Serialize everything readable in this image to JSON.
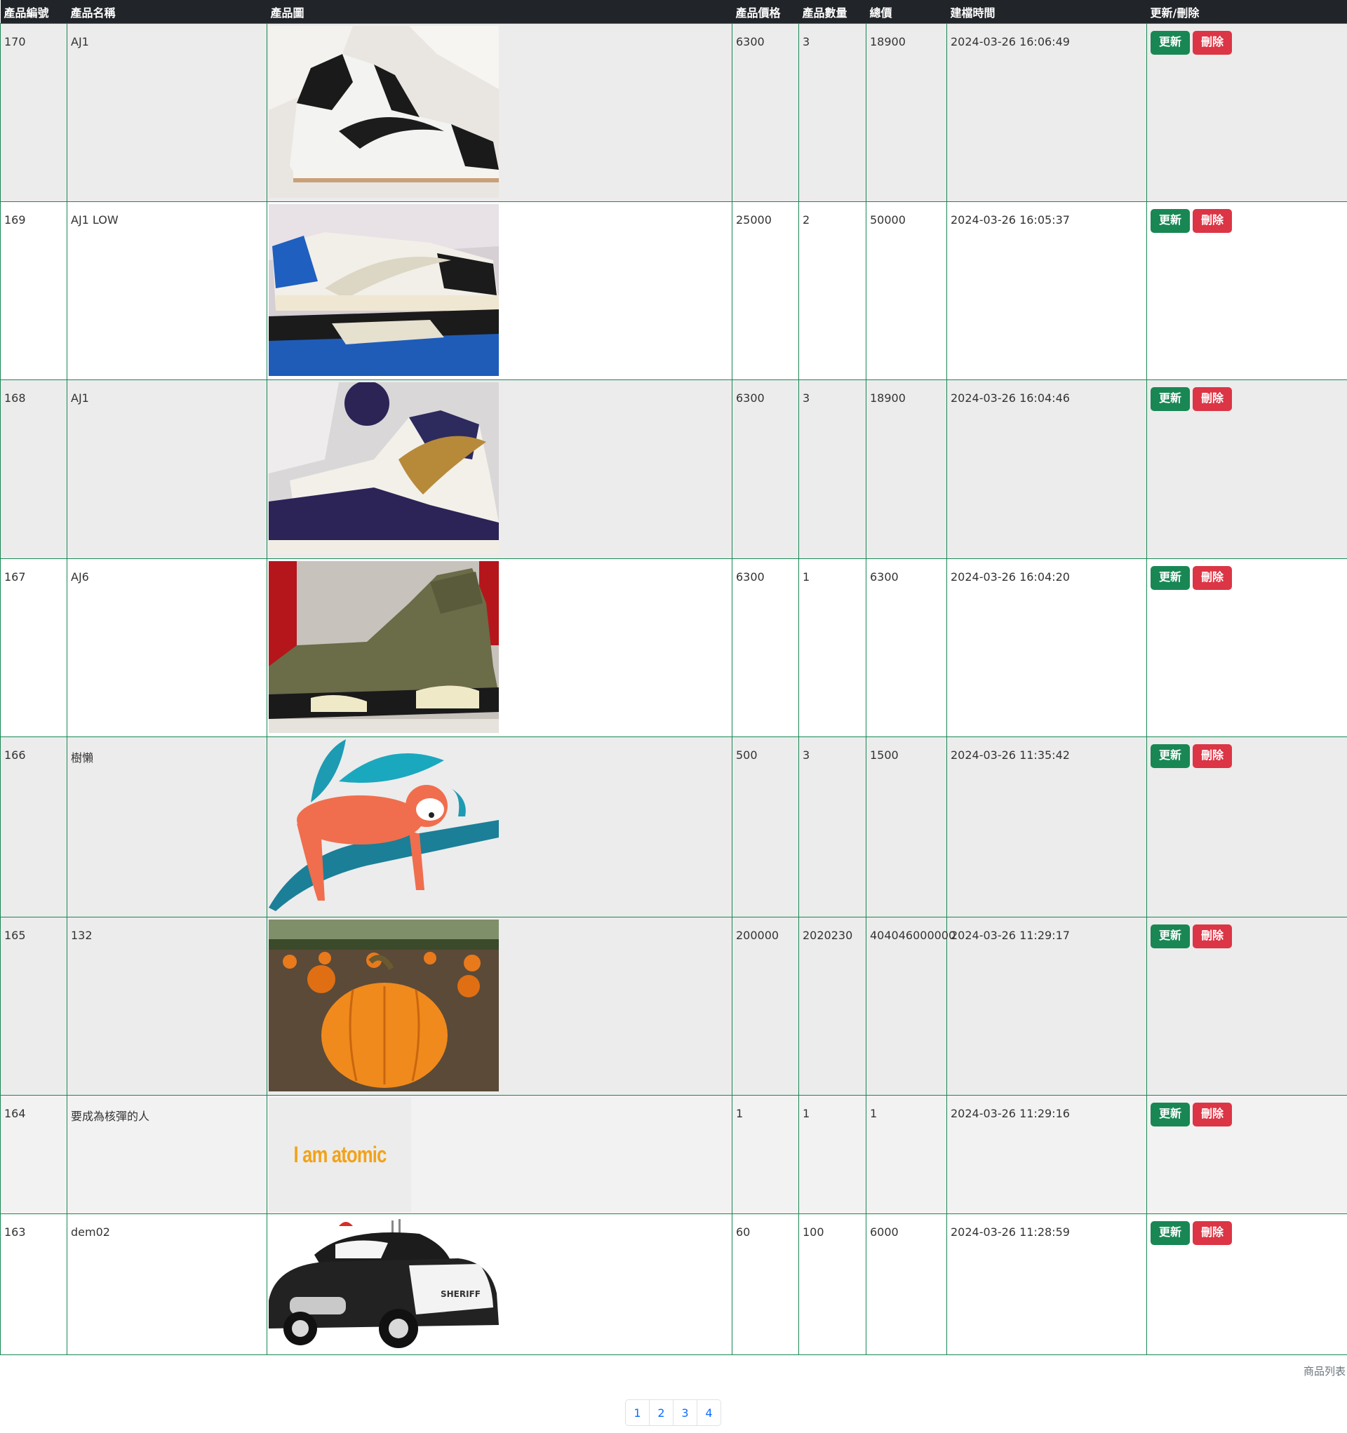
{
  "headers": {
    "id": "產品編號",
    "name": "產品名稱",
    "image": "產品圖",
    "price": "產品價格",
    "qty": "產品數量",
    "total": "總價",
    "created": "建檔時間",
    "actions": "更新/刪除"
  },
  "buttons": {
    "update": "更新",
    "delete": "刪除"
  },
  "rows": [
    {
      "id": "170",
      "name": "AJ1",
      "image_icon": "sneaker-black-white-image",
      "price": "6300",
      "qty": "3",
      "total": "18900",
      "created": "2024-03-26 16:06:49"
    },
    {
      "id": "169",
      "name": "AJ1 LOW",
      "image_icon": "sneaker-low-blue-image",
      "price": "25000",
      "qty": "2",
      "total": "50000",
      "created": "2024-03-26 16:05:37"
    },
    {
      "id": "168",
      "name": "AJ1",
      "image_icon": "sneaker-purple-gold-image",
      "price": "6300",
      "qty": "3",
      "total": "18900",
      "created": "2024-03-26 16:04:46"
    },
    {
      "id": "167",
      "name": "AJ6",
      "image_icon": "sneaker-olive-image",
      "price": "6300",
      "qty": "1",
      "total": "6300",
      "created": "2024-03-26 16:04:20"
    },
    {
      "id": "166",
      "name": "樹懶",
      "image_icon": "sloth-illustration-image",
      "price": "500",
      "qty": "3",
      "total": "1500",
      "created": "2024-03-26 11:35:42"
    },
    {
      "id": "165",
      "name": "132",
      "image_icon": "pumpkin-field-image",
      "price": "200000",
      "qty": "2020230",
      "total": "404046000000",
      "created": "2024-03-26 11:29:17"
    },
    {
      "id": "164",
      "name": "要成為核彈的人",
      "image_icon": "i-am-atomic-image",
      "image_text": "I am atomic",
      "price": "1",
      "qty": "1",
      "total": "1",
      "created": "2024-03-26 11:29:16"
    },
    {
      "id": "163",
      "name": "dem02",
      "image_icon": "sheriff-car-image",
      "image_text": "SHERIFF",
      "price": "60",
      "qty": "100",
      "total": "6000",
      "created": "2024-03-26 11:28:59"
    }
  ],
  "caption": "商品列表",
  "pagination": [
    "1",
    "2",
    "3",
    "4"
  ],
  "colors": {
    "header_bg": "#212529",
    "update": "#198754",
    "delete": "#dc3545",
    "border": "#198754",
    "link": "#0d6efd"
  }
}
